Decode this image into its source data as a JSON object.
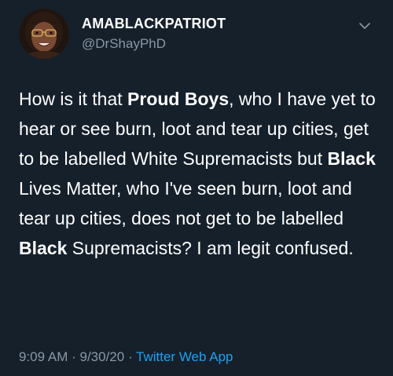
{
  "author": {
    "display_name": "AMABLACKPATRIOT",
    "handle": "@DrShayPhD"
  },
  "tweet": {
    "segments": [
      {
        "text": "How is it that ",
        "bold": false
      },
      {
        "text": "Proud Boys",
        "bold": true
      },
      {
        "text": ", who I have yet to hear or see burn, loot and tear up cities, get to be labelled White Supremacists but ",
        "bold": false
      },
      {
        "text": "Black",
        "bold": true
      },
      {
        "text": " Lives Matter, who I've seen burn, loot and tear up cities, does not get to be labelled ",
        "bold": false
      },
      {
        "text": "Black",
        "bold": true
      },
      {
        "text": " Supremacists? I am legit confused.",
        "bold": false
      }
    ]
  },
  "meta": {
    "time": "9:09 AM",
    "separator1": " · ",
    "date": "9/30/20",
    "separator2": " · ",
    "app": "Twitter Web App"
  },
  "icons": {
    "menu": "chevron-down-icon",
    "avatar": "profile-photo"
  },
  "colors": {
    "background": "#15202b",
    "text": "#ffffff",
    "secondary": "#8899a6",
    "link": "#1da1f2"
  }
}
